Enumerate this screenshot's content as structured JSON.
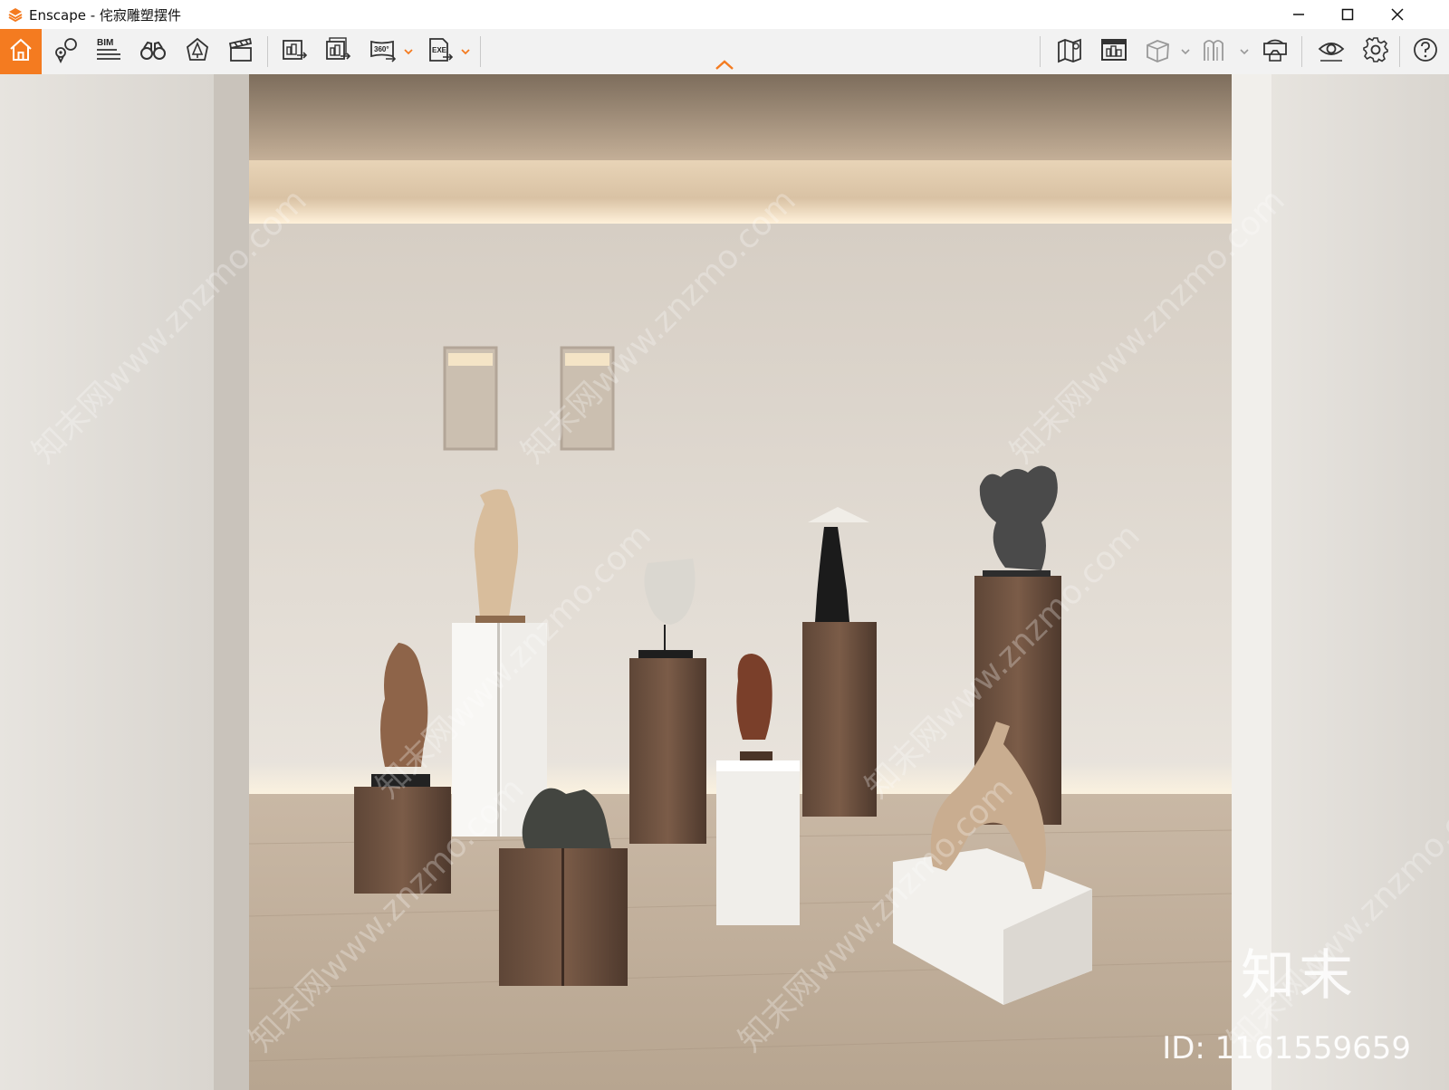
{
  "window": {
    "app_name": "Enscape",
    "title": "Enscape - 侘寂雕塑摆件",
    "minimize_icon": "minimize-icon",
    "maximize_icon": "maximize-icon",
    "close_icon": "close-icon"
  },
  "toolbar": {
    "accent_color": "#f47b20",
    "left_tools": [
      {
        "name": "home",
        "icon": "home-icon",
        "active": true
      },
      {
        "name": "views",
        "icon": "location-pin-icon"
      },
      {
        "name": "bim",
        "icon": "bim-icon",
        "label": "BIM"
      },
      {
        "name": "asset-library",
        "icon": "binoculars-icon"
      },
      {
        "name": "material-editor",
        "icon": "tree-icon"
      },
      {
        "name": "video-editor",
        "icon": "clapperboard-icon"
      }
    ],
    "export_tools": [
      {
        "name": "render-image",
        "icon": "render-image-icon"
      },
      {
        "name": "batch-render",
        "icon": "batch-render-icon"
      },
      {
        "name": "panorama",
        "icon": "panorama-360-icon",
        "label": "360°"
      },
      {
        "name": "export-exe",
        "icon": "exe-export-icon",
        "label": "EXE"
      }
    ],
    "right_tools": [
      {
        "name": "map",
        "icon": "map-icon"
      },
      {
        "name": "web-standalone",
        "icon": "web-standalone-icon"
      },
      {
        "name": "cube-view",
        "icon": "cube-icon"
      },
      {
        "name": "sync",
        "icon": "sync-icon"
      },
      {
        "name": "vr-headset",
        "icon": "vr-headset-icon"
      },
      {
        "name": "visual-settings",
        "icon": "eye-icon"
      },
      {
        "name": "settings",
        "icon": "gear-icon"
      },
      {
        "name": "help",
        "icon": "help-icon"
      }
    ],
    "collapse_icon": "chevron-up-icon"
  },
  "viewport": {
    "scene": "gallery-with-sculptures-on-pedestals",
    "watermark_logo": "知末",
    "watermark_id": "ID: 1161559659",
    "watermark_diagonal": "知末网www.znzmo.com"
  }
}
